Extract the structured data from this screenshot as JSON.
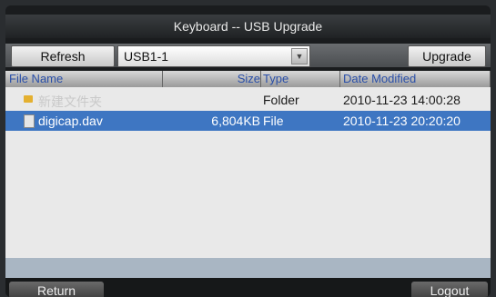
{
  "window": {
    "title": "Keyboard -- USB Upgrade"
  },
  "toolbar": {
    "refresh_label": "Refresh",
    "device_value": "USB1-1",
    "upgrade_label": "Upgrade"
  },
  "columns": [
    "File Name",
    "Size",
    "Type",
    "Date Modified"
  ],
  "files": [
    {
      "name": "新建文件夹",
      "size": "",
      "type": "Folder",
      "date": "2010-11-23 14:00:28",
      "icon": "folder-icon"
    },
    {
      "name": "digicap.dav",
      "size": "6,804KB",
      "type": "File",
      "date": "2010-11-23 20:20:20",
      "icon": "file-icon"
    }
  ],
  "footer": {
    "return_label": "Return",
    "logout_label": "Logout"
  },
  "colors": {
    "selection": "#3e76c2",
    "accent_header_text": "#2a4fa8"
  }
}
